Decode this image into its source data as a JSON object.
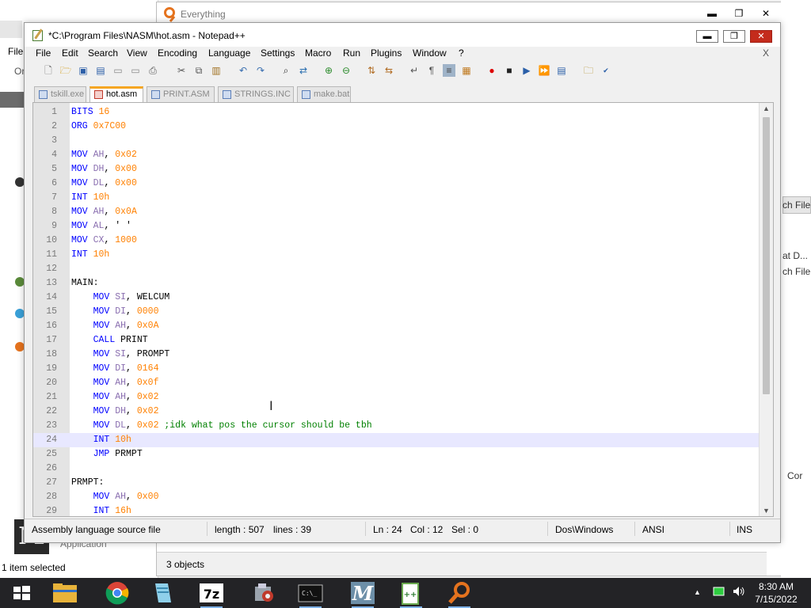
{
  "background": {
    "explorer": {
      "menu_file": "File",
      "menu_or": "Or",
      "status": "1 item selected",
      "app_label": "Application"
    },
    "everything": {
      "title": "Everything",
      "status": "3 objects"
    },
    "right_edge": {
      "labels": [
        "ch File",
        "at D...",
        "ch File",
        "Cor"
      ]
    }
  },
  "window": {
    "title": "*C:\\Program Files\\NASM\\hot.asm - Notepad++",
    "minimize": "▬",
    "maximize": "❐",
    "close": "✕"
  },
  "menu": {
    "items": [
      "File",
      "Edit",
      "Search",
      "View",
      "Encoding",
      "Language",
      "Settings",
      "Macro",
      "Run",
      "Plugins",
      "Window",
      "?"
    ],
    "close_doc": "X"
  },
  "toolbar": {
    "icons": [
      "new-file-icon",
      "open-file-icon",
      "save-icon",
      "save-all-icon",
      "close-icon",
      "close-all-icon",
      "print-icon",
      "cut-icon",
      "copy-icon",
      "paste-icon",
      "undo-icon",
      "redo-icon",
      "find-icon",
      "replace-icon",
      "zoom-in-icon",
      "zoom-out-icon",
      "sync-v-icon",
      "sync-h-icon",
      "word-wrap-icon",
      "show-all-chars-icon",
      "indent-guide-icon",
      "doc-map-icon",
      "record-macro-icon",
      "stop-macro-icon",
      "play-macro-icon",
      "run-macro-multiple-icon",
      "save-macro-icon",
      "folder-icon",
      "spellcheck-icon"
    ]
  },
  "tabs": [
    {
      "label": "tskill.exe",
      "active": false
    },
    {
      "label": "hot.asm",
      "active": true
    },
    {
      "label": "PRINT.ASM",
      "active": false
    },
    {
      "label": "STRINGS.INC",
      "active": false
    },
    {
      "label": "make.bat",
      "active": false
    }
  ],
  "editor": {
    "current_line": 24,
    "lines": [
      {
        "n": "1",
        "tokens": [
          [
            "k",
            "BITS"
          ],
          [
            "i",
            " "
          ],
          [
            "n",
            "16"
          ]
        ]
      },
      {
        "n": "2",
        "tokens": [
          [
            "k",
            "ORG"
          ],
          [
            "i",
            " "
          ],
          [
            "n",
            "0x7C00"
          ]
        ]
      },
      {
        "n": "3",
        "tokens": []
      },
      {
        "n": "4",
        "tokens": [
          [
            "k",
            "MOV"
          ],
          [
            "i",
            " "
          ],
          [
            "r",
            "AH"
          ],
          [
            "i",
            ", "
          ],
          [
            "n",
            "0x02"
          ]
        ]
      },
      {
        "n": "5",
        "tokens": [
          [
            "k",
            "MOV"
          ],
          [
            "i",
            " "
          ],
          [
            "r",
            "DH"
          ],
          [
            "i",
            ", "
          ],
          [
            "n",
            "0x00"
          ]
        ]
      },
      {
        "n": "6",
        "tokens": [
          [
            "k",
            "MOV"
          ],
          [
            "i",
            " "
          ],
          [
            "r",
            "DL"
          ],
          [
            "i",
            ", "
          ],
          [
            "n",
            "0x00"
          ]
        ]
      },
      {
        "n": "7",
        "tokens": [
          [
            "k",
            "INT"
          ],
          [
            "i",
            " "
          ],
          [
            "n",
            "10h"
          ]
        ]
      },
      {
        "n": "8",
        "tokens": [
          [
            "k",
            "MOV"
          ],
          [
            "i",
            " "
          ],
          [
            "r",
            "AH"
          ],
          [
            "i",
            ", "
          ],
          [
            "n",
            "0x0A"
          ]
        ]
      },
      {
        "n": "9",
        "tokens": [
          [
            "k",
            "MOV"
          ],
          [
            "i",
            " "
          ],
          [
            "r",
            "AL"
          ],
          [
            "i",
            ", ' '"
          ]
        ]
      },
      {
        "n": "10",
        "tokens": [
          [
            "k",
            "MOV"
          ],
          [
            "i",
            " "
          ],
          [
            "r",
            "CX"
          ],
          [
            "i",
            ", "
          ],
          [
            "n",
            "1000"
          ]
        ]
      },
      {
        "n": "11",
        "tokens": [
          [
            "k",
            "INT"
          ],
          [
            "i",
            " "
          ],
          [
            "n",
            "10h"
          ]
        ]
      },
      {
        "n": "12",
        "tokens": []
      },
      {
        "n": "13",
        "tokens": [
          [
            "i",
            "MAIN:"
          ]
        ]
      },
      {
        "n": "14",
        "tokens": [
          [
            "i",
            "    "
          ],
          [
            "k",
            "MOV"
          ],
          [
            "i",
            " "
          ],
          [
            "r",
            "SI"
          ],
          [
            "i",
            ", WELCUM"
          ]
        ]
      },
      {
        "n": "15",
        "tokens": [
          [
            "i",
            "    "
          ],
          [
            "k",
            "MOV"
          ],
          [
            "i",
            " "
          ],
          [
            "r",
            "DI"
          ],
          [
            "i",
            ", "
          ],
          [
            "n",
            "0000"
          ]
        ]
      },
      {
        "n": "16",
        "tokens": [
          [
            "i",
            "    "
          ],
          [
            "k",
            "MOV"
          ],
          [
            "i",
            " "
          ],
          [
            "r",
            "AH"
          ],
          [
            "i",
            ", "
          ],
          [
            "n",
            "0x0A"
          ]
        ]
      },
      {
        "n": "17",
        "tokens": [
          [
            "i",
            "    "
          ],
          [
            "k",
            "CALL"
          ],
          [
            "i",
            " PRINT"
          ]
        ]
      },
      {
        "n": "18",
        "tokens": [
          [
            "i",
            "    "
          ],
          [
            "k",
            "MOV"
          ],
          [
            "i",
            " "
          ],
          [
            "r",
            "SI"
          ],
          [
            "i",
            ", PROMPT"
          ]
        ]
      },
      {
        "n": "19",
        "tokens": [
          [
            "i",
            "    "
          ],
          [
            "k",
            "MOV"
          ],
          [
            "i",
            " "
          ],
          [
            "r",
            "DI"
          ],
          [
            "i",
            ", "
          ],
          [
            "n",
            "0164"
          ]
        ]
      },
      {
        "n": "20",
        "tokens": [
          [
            "i",
            "    "
          ],
          [
            "k",
            "MOV"
          ],
          [
            "i",
            " "
          ],
          [
            "r",
            "AH"
          ],
          [
            "i",
            ", "
          ],
          [
            "n",
            "0x0f"
          ]
        ]
      },
      {
        "n": "21",
        "tokens": [
          [
            "i",
            "    "
          ],
          [
            "k",
            "MOV"
          ],
          [
            "i",
            " "
          ],
          [
            "r",
            "AH"
          ],
          [
            "i",
            ", "
          ],
          [
            "n",
            "0x02"
          ]
        ]
      },
      {
        "n": "22",
        "tokens": [
          [
            "i",
            "    "
          ],
          [
            "k",
            "MOV"
          ],
          [
            "i",
            " "
          ],
          [
            "r",
            "DH"
          ],
          [
            "i",
            ", "
          ],
          [
            "n",
            "0x02"
          ]
        ]
      },
      {
        "n": "23",
        "tokens": [
          [
            "i",
            "    "
          ],
          [
            "k",
            "MOV"
          ],
          [
            "i",
            " "
          ],
          [
            "r",
            "DL"
          ],
          [
            "i",
            ", "
          ],
          [
            "n",
            "0x02"
          ],
          [
            "i",
            " "
          ],
          [
            "c",
            ";idk what pos the cursor should be tbh"
          ]
        ]
      },
      {
        "n": "24",
        "tokens": [
          [
            "i",
            "    "
          ],
          [
            "k",
            "INT"
          ],
          [
            "i",
            " "
          ],
          [
            "n",
            "10h"
          ]
        ]
      },
      {
        "n": "25",
        "tokens": [
          [
            "i",
            "    "
          ],
          [
            "k",
            "JMP"
          ],
          [
            "i",
            " PRMPT"
          ]
        ]
      },
      {
        "n": "26",
        "tokens": []
      },
      {
        "n": "27",
        "tokens": [
          [
            "i",
            "PRMPT:"
          ]
        ]
      },
      {
        "n": "28",
        "tokens": [
          [
            "i",
            "    "
          ],
          [
            "k",
            "MOV"
          ],
          [
            "i",
            " "
          ],
          [
            "r",
            "AH"
          ],
          [
            "i",
            ", "
          ],
          [
            "n",
            "0x00"
          ]
        ]
      },
      {
        "n": "29",
        "tokens": [
          [
            "i",
            "    "
          ],
          [
            "k",
            "INT"
          ],
          [
            "i",
            " "
          ],
          [
            "n",
            "16h"
          ]
        ]
      }
    ]
  },
  "status": {
    "file_type": "Assembly language source file",
    "length": "length : 507",
    "lines": "lines : 39",
    "ln": "Ln : 24",
    "col": "Col : 12",
    "sel": "Sel : 0",
    "eol": "Dos\\Windows",
    "encoding": "ANSI",
    "mode": "INS"
  },
  "taskbar": {
    "apps": [
      "start-icon",
      "file-explorer-icon",
      "chrome-icon",
      "notepad-icon",
      "7zip-icon",
      "settings-app-icon",
      "cmd-icon",
      "masm-icon",
      "notepadpp-icon",
      "everything-icon"
    ],
    "time": "8:30 AM",
    "date": "7/15/2022",
    "tray_arrow": "▲"
  },
  "colors": {
    "keyword": "#0000ff",
    "register": "#8a6fb0",
    "number": "#ff8000",
    "comment": "#008000",
    "close_button": "#c42b1c",
    "active_tab_accent": "#f5a623"
  }
}
